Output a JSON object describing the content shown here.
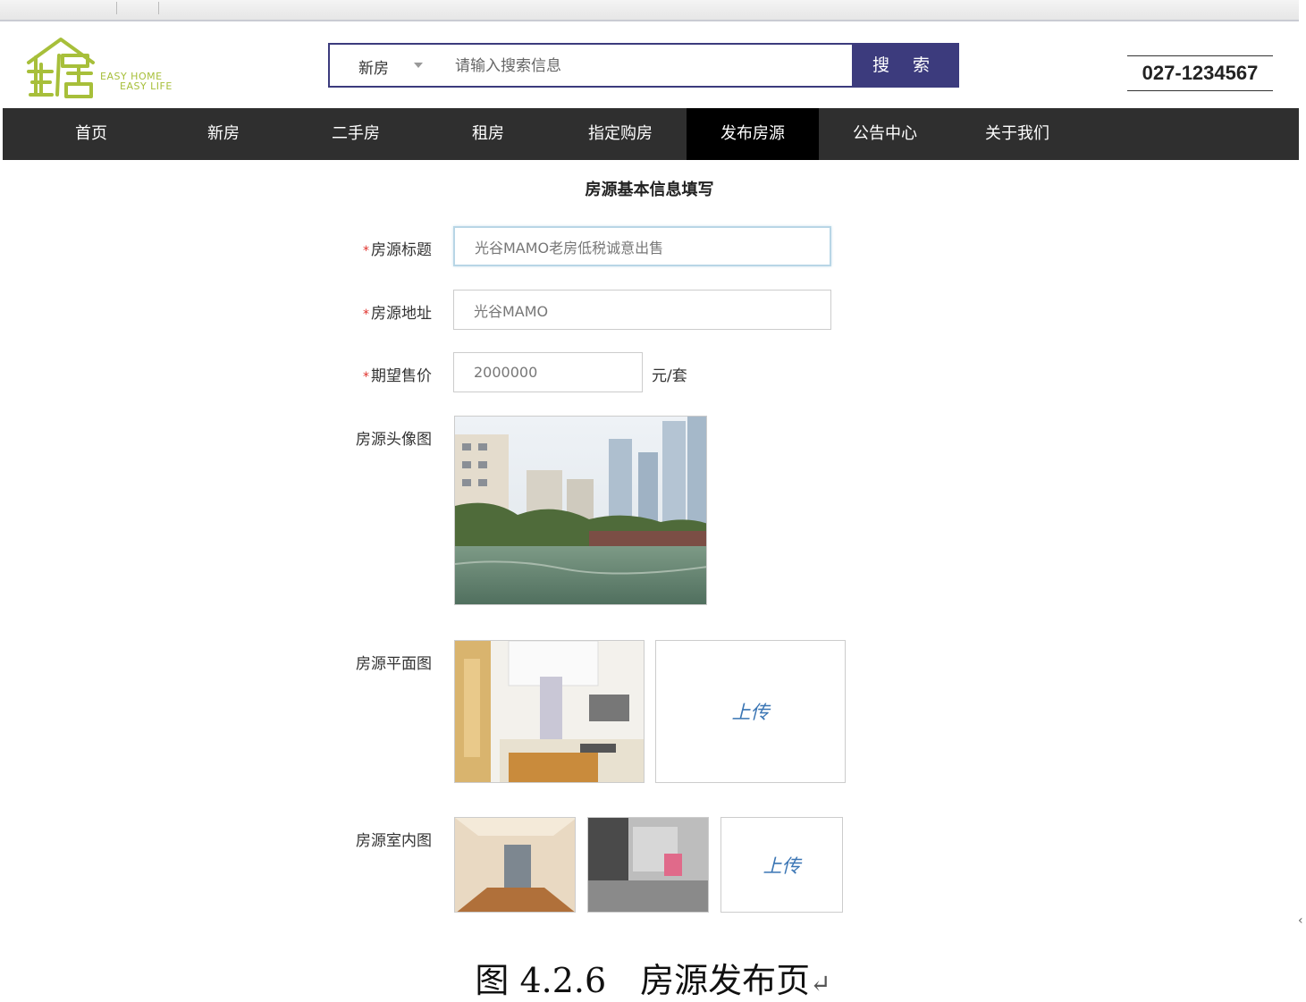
{
  "logo": {
    "cn": "易居",
    "en_line1": "EASY HOME",
    "en_line2": "EASY LIFE",
    "brand_color": "#a7bf3a"
  },
  "search": {
    "category": "新房",
    "placeholder": "请输入搜索信息",
    "button": "搜 索",
    "accent": "#3c3b7d"
  },
  "phone": "027-1234567",
  "nav": {
    "items": [
      "首页",
      "新房",
      "二手房",
      "租房",
      "指定购房",
      "发布房源",
      "公告中心",
      "关于我们"
    ],
    "active": "发布房源"
  },
  "form": {
    "heading": "房源基本信息填写",
    "title": {
      "label": "房源标题",
      "value": "光谷MAMO老房低税诚意出售"
    },
    "address": {
      "label": "房源地址",
      "value": "光谷MAMO"
    },
    "price": {
      "label": "期望售价",
      "value": "2000000",
      "unit": "元/套"
    },
    "cover_label": "房源头像图",
    "floorplan_label": "房源平面图",
    "interior_label": "房源室内图",
    "upload_label": "上传",
    "upload_label_2": "上传",
    "required_mark": "*"
  },
  "caption": {
    "text": "图 4.2.6　房源发布页",
    "return_mark": "↵"
  },
  "side_mark": "‹"
}
